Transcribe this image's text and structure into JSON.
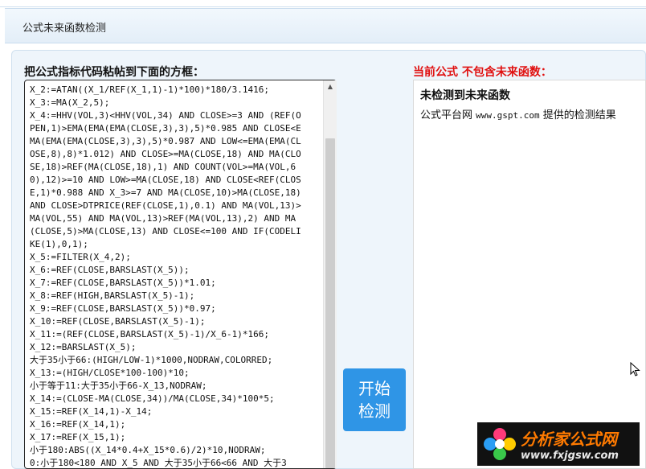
{
  "window": {
    "title": "公式未来函数检测"
  },
  "editor": {
    "label": "把公式指标代码粘帖到下面的方框：",
    "lines": [
      "X_2:=ATAN((X_1/REF(X_1,1)-1)*100)*180/3.1416;",
      "X_3:=MA(X_2,5);",
      "X_4:=HHV(VOL,3)<HHV(VOL,34) AND CLOSE>=3 AND (REF(O",
      "PEN,1)>EMA(EMA(EMA(CLOSE,3),3),5)*0.985 AND CLOSE<E",
      "MA(EMA(EMA(CLOSE,3),3),5)*0.987 AND LOW<=EMA(EMA(CL",
      "OSE,8),8)*1.012) AND CLOSE>=MA(CLOSE,18) AND MA(CLO",
      "SE,18)>REF(MA(CLOSE,18),1) AND COUNT(VOL>=MA(VOL,6",
      "0),12)>=10 AND LOW>=MA(CLOSE,18) AND CLOSE<REF(CLOS",
      "E,1)*0.988 AND X_3>=7 AND MA(CLOSE,10)>MA(CLOSE,18)",
      "AND CLOSE>DTPRICE(REF(CLOSE,1),0.1) AND MA(VOL,13)>",
      "MA(VOL,55) AND MA(VOL,13)>REF(MA(VOL,13),2) AND MA",
      "(CLOSE,5)>MA(CLOSE,13) AND CLOSE<=100 AND IF(CODELI",
      "KE(1),0,1);",
      "X_5:=FILTER(X_4,2);",
      "X_6:=REF(CLOSE,BARSLAST(X_5));",
      "X_7:=REF(CLOSE,BARSLAST(X_5))*1.01;",
      "X_8:=REF(HIGH,BARSLAST(X_5)-1);",
      "X_9:=REF(CLOSE,BARSLAST(X_5))*0.97;",
      "X_10:=REF(CLOSE,BARSLAST(X_5)-1);",
      "X_11:=(REF(CLOSE,BARSLAST(X_5)-1)/X_6-1)*166;",
      "X_12:=BARSLAST(X_5);",
      "大于35小于66:(HIGH/LOW-1)*1000,NODRAW,COLORRED;",
      "X_13:=(HIGH/CLOSE*100-100)*10;",
      "小于等于11:大于35小于66-X_13,NODRAW;",
      "X_14:=(CLOSE-MA(CLOSE,34))/MA(CLOSE,34)*100*5;",
      "X_15:=REF(X_14,1)-X_14;",
      "X_16:=REF(X_14,1);",
      "X_17:=REF(X_15,1);",
      "小于180:ABS((X_14*0.4+X_15*0.6)/2)*10,NODRAW;",
      "0:小于180<180 AND X_5 AND 大于35小于66<66 AND 大于3"
    ]
  },
  "detect_button": {
    "line1": "开始",
    "line2": "检测"
  },
  "result": {
    "label": "当前公式 不包含未来函数：",
    "title": "未检测到未来函数",
    "line_prefix": "公式平台网",
    "line_site": "www.gspt.com",
    "line_suffix": "提供的检测结果"
  },
  "watermark": {
    "cn": "分析家公式网",
    "en": "www.fxjgsw.com"
  }
}
